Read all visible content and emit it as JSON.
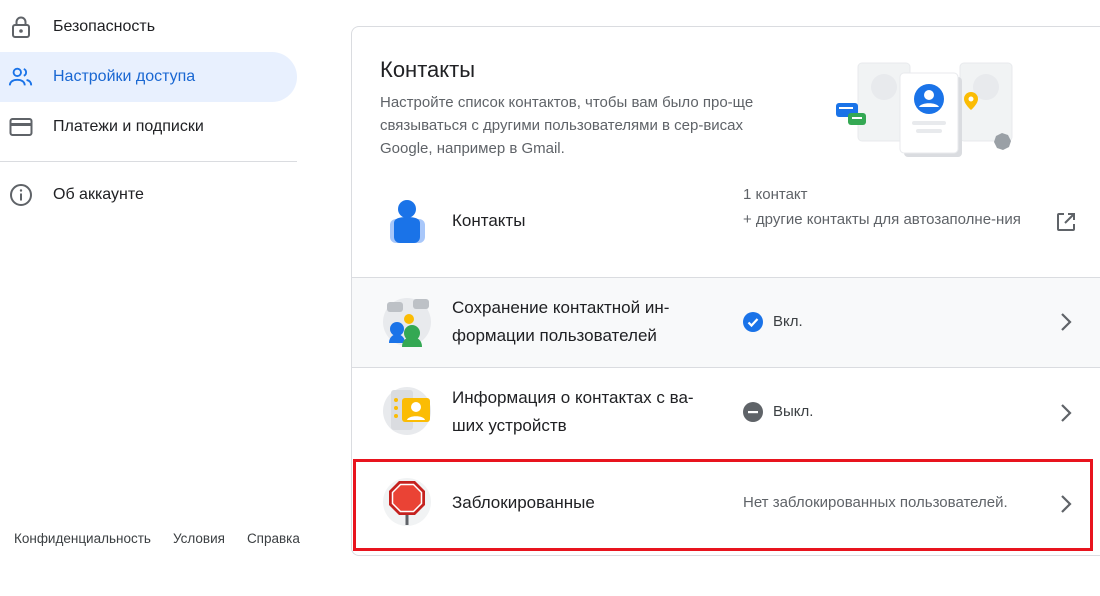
{
  "sidebar": {
    "items": [
      {
        "label": "Безопасность",
        "icon": "lock-icon"
      },
      {
        "label": "Настройки доступа",
        "icon": "people-icon",
        "active": true
      },
      {
        "label": "Платежи и подписки",
        "icon": "credit-card-icon"
      },
      {
        "label": "Об аккаунте",
        "icon": "info-icon"
      }
    ]
  },
  "footer": {
    "privacy": "Конфиденциальность",
    "terms": "Условия",
    "help": "Справка"
  },
  "card": {
    "title": "Контакты",
    "description": "Настройте список контактов, чтобы вам было про-ще связываться с другими пользователями в сер-висах Google, например в Gmail.",
    "rows": [
      {
        "title": "Контакты",
        "value_line1": "1 контакт",
        "value_line2": "+ другие контакты для автозаполне-ния",
        "action_icon": "open-in-new-icon"
      },
      {
        "title": "Сохранение контактной ин-формации пользователей",
        "status": "Вкл.",
        "status_icon": "check-circle-icon",
        "action_icon": "chevron-right-icon"
      },
      {
        "title": "Информация о контактах с ва-ших устройств",
        "status": "Выкл.",
        "status_icon": "minus-circle-icon",
        "action_icon": "chevron-right-icon"
      },
      {
        "title": "Заблокированные",
        "value": "Нет заблокированных пользователей.",
        "action_icon": "chevron-right-icon"
      }
    ]
  },
  "colors": {
    "accent": "#1a73e8",
    "active_bg": "#e8f0fe",
    "active_text": "#1967d2",
    "highlight": "#e8141e"
  }
}
